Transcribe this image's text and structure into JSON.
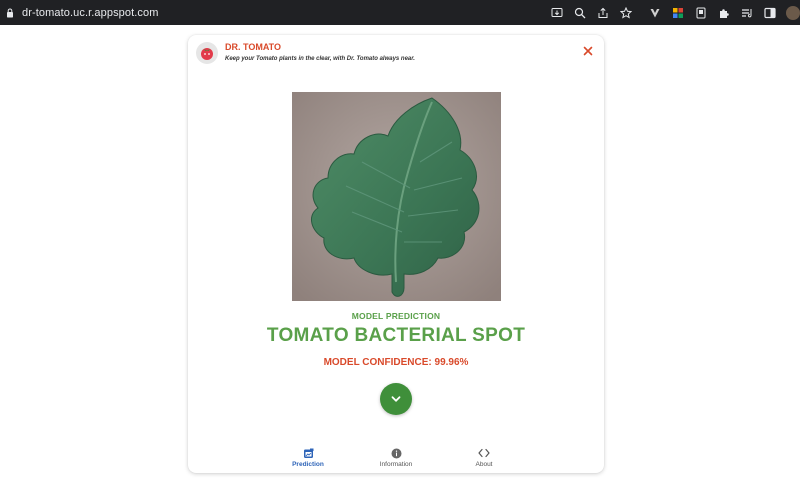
{
  "browser": {
    "url": "dr-tomato.uc.r.appspot.com"
  },
  "app": {
    "title": "DR. TOMATO",
    "tagline": "Keep your Tomato plants in the clear, with Dr. Tomato always near."
  },
  "result": {
    "label": "MODEL PREDICTION",
    "prediction": "TOMATO BACTERIAL SPOT",
    "confidence_text": "MODEL CONFIDENCE: 99.96%"
  },
  "nav": {
    "items": [
      {
        "label": "Prediction",
        "icon": "prediction-icon",
        "active": true
      },
      {
        "label": "Information",
        "icon": "info-icon",
        "active": false
      },
      {
        "label": "About",
        "icon": "code-icon",
        "active": false
      }
    ]
  },
  "colors": {
    "brand_red": "#d94a2b",
    "brand_green": "#5aa04a",
    "fab_green": "#3f8f3a",
    "nav_active": "#2e64b8"
  }
}
